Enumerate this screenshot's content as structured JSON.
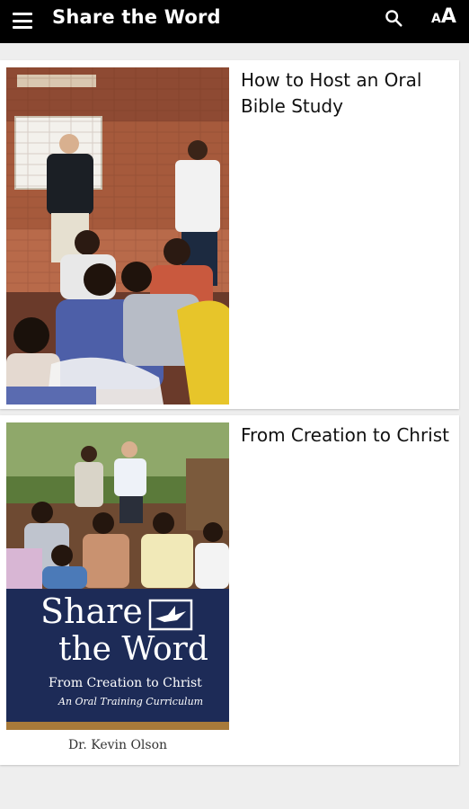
{
  "appbar": {
    "title": "Share the Word",
    "font_small": "A",
    "font_big": "A"
  },
  "cards": [
    {
      "title": "How to Host an Oral Bible Study"
    },
    {
      "title": "From Creation to Christ",
      "cover": {
        "line1": "Share",
        "line2": "the Word",
        "subtitle": "From Creation to Christ",
        "tagline": "An Oral Training Curriculum",
        "author": "Dr. Kevin Olson"
      }
    }
  ],
  "colors": {
    "appbar": "#000000",
    "background": "#eeeeee",
    "card": "#ffffff",
    "cover_blue": "#1d2b57"
  }
}
